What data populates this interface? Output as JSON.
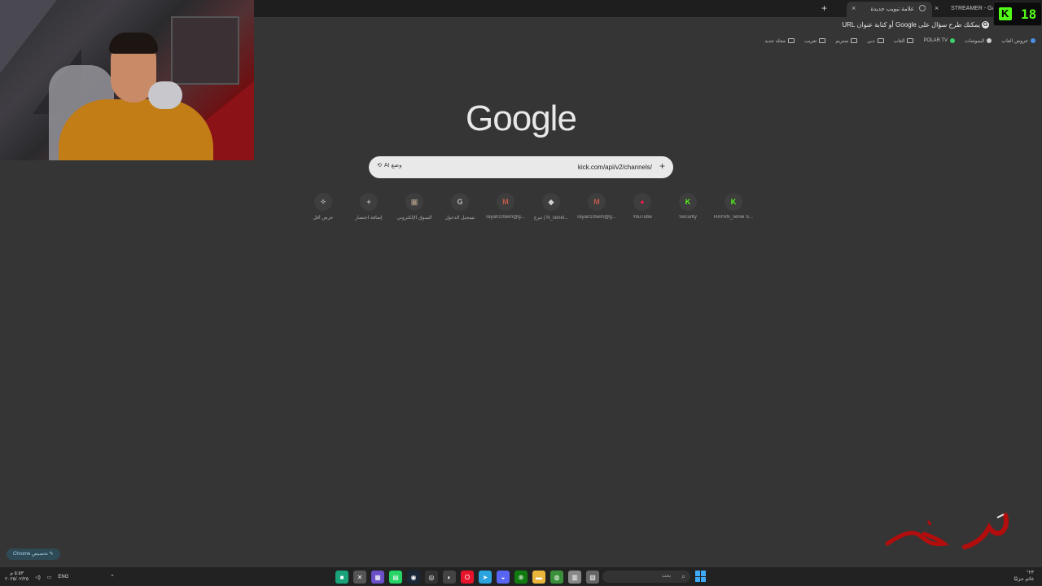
{
  "tabs": {
    "active_title": "علامة تبويب جديدة",
    "inactive_title": "STREAMER - GAM",
    "close_glyph": "×",
    "new_tab_glyph": "+"
  },
  "omnibox": {
    "text": "يمكنك طرح سؤال على Google أو كتابة عنوان URL",
    "icon": "G"
  },
  "bookmarks": [
    {
      "label": "مجلد جديد",
      "icon": "folder-icon"
    },
    {
      "label": "تعريب",
      "icon": "folder-icon"
    },
    {
      "label": "ستريم",
      "icon": "folder-icon"
    },
    {
      "label": "دبي",
      "icon": "folder-icon"
    },
    {
      "label": "العاب",
      "icon": "folder-icon"
    },
    {
      "label": "POLAR TV",
      "icon": "polar-icon",
      "color": "#3ecf6a"
    },
    {
      "label": "اليموشات",
      "icon": "pin-icon",
      "color": "#cccccc"
    },
    {
      "label": "عروض العاب",
      "icon": "offer-icon",
      "color": "#4a8fe0"
    }
  ],
  "logo": "Google",
  "search": {
    "value": "kick.com/api/v2/channels/",
    "plus": "+",
    "ai_label": "وضع AI",
    "ai_icon": "⟲"
  },
  "shortcuts": [
    {
      "label": "RAYAN_senei S...",
      "glyph": "K",
      "color": "#53fc18"
    },
    {
      "label": "Security",
      "glyph": "K",
      "color": "#53fc18"
    },
    {
      "label": "YouTube",
      "glyph": "●",
      "color": "#e0204a"
    },
    {
      "label": "rayan105km@g...",
      "glyph": "M",
      "color": "#c25a4a"
    },
    {
      "label": "تبرع | N_senei...",
      "glyph": "◆",
      "color": "#cfcfcf"
    },
    {
      "label": "rayan105km@g...",
      "glyph": "M",
      "color": "#c25a4a"
    },
    {
      "label": "تسجيل الدخول",
      "glyph": "G",
      "color": "#bbbbbb"
    },
    {
      "label": "السوق الإلكتروني",
      "glyph": "▣",
      "color": "#9a8a7a"
    },
    {
      "label": "إضافة اختصار",
      "glyph": "+",
      "color": "#bbbbbb"
    },
    {
      "label": "عرض أقل",
      "glyph": "✧",
      "color": "#aaaaaa"
    }
  ],
  "kick": {
    "k": "K",
    "count": "18",
    "color": "#53fc18"
  },
  "customize_label": "✎ تخصيص Chrome",
  "taskbar": {
    "search_placeholder": "بحث",
    "search_icon": "⌕",
    "weather_temp": "٢٣°",
    "weather_desc": "غائم جزئيًا",
    "lang": "ENG",
    "clock_time": "٥:٥٣ م",
    "clock_date": "٢٠٢٥/٠٢/٢٥",
    "tray_glyph": "^",
    "apps": [
      {
        "name": "greenapp-icon",
        "glyph": "■",
        "color": "#1aa37a"
      },
      {
        "name": "xbox-bar-icon",
        "glyph": "✕",
        "color": "#555555"
      },
      {
        "name": "grid-app-icon",
        "glyph": "▦",
        "color": "#6a4fc8"
      },
      {
        "name": "whatsapp-icon",
        "glyph": "▤",
        "color": "#25d366"
      },
      {
        "name": "steam-icon",
        "glyph": "◉",
        "color": "#1b2838"
      },
      {
        "name": "obs-icon",
        "glyph": "◎",
        "color": "#333333"
      },
      {
        "name": "epic-icon",
        "glyph": "◐",
        "color": "#444444"
      },
      {
        "name": "opera-icon",
        "glyph": "O",
        "color": "#e8142b"
      },
      {
        "name": "telegram-icon",
        "glyph": "➤",
        "color": "#2aa3df"
      },
      {
        "name": "discord-icon",
        "glyph": "◒",
        "color": "#5865f2"
      },
      {
        "name": "xbox-icon",
        "glyph": "⊗",
        "color": "#107c10"
      },
      {
        "name": "explorer-icon",
        "glyph": "▬",
        "color": "#e9b53b"
      },
      {
        "name": "chrome-icon",
        "glyph": "◍",
        "color": "#3a8f3a"
      },
      {
        "name": "notepad-icon",
        "glyph": "▥",
        "color": "#888888"
      },
      {
        "name": "widgets-icon",
        "glyph": "▧",
        "color": "#666666"
      }
    ]
  }
}
